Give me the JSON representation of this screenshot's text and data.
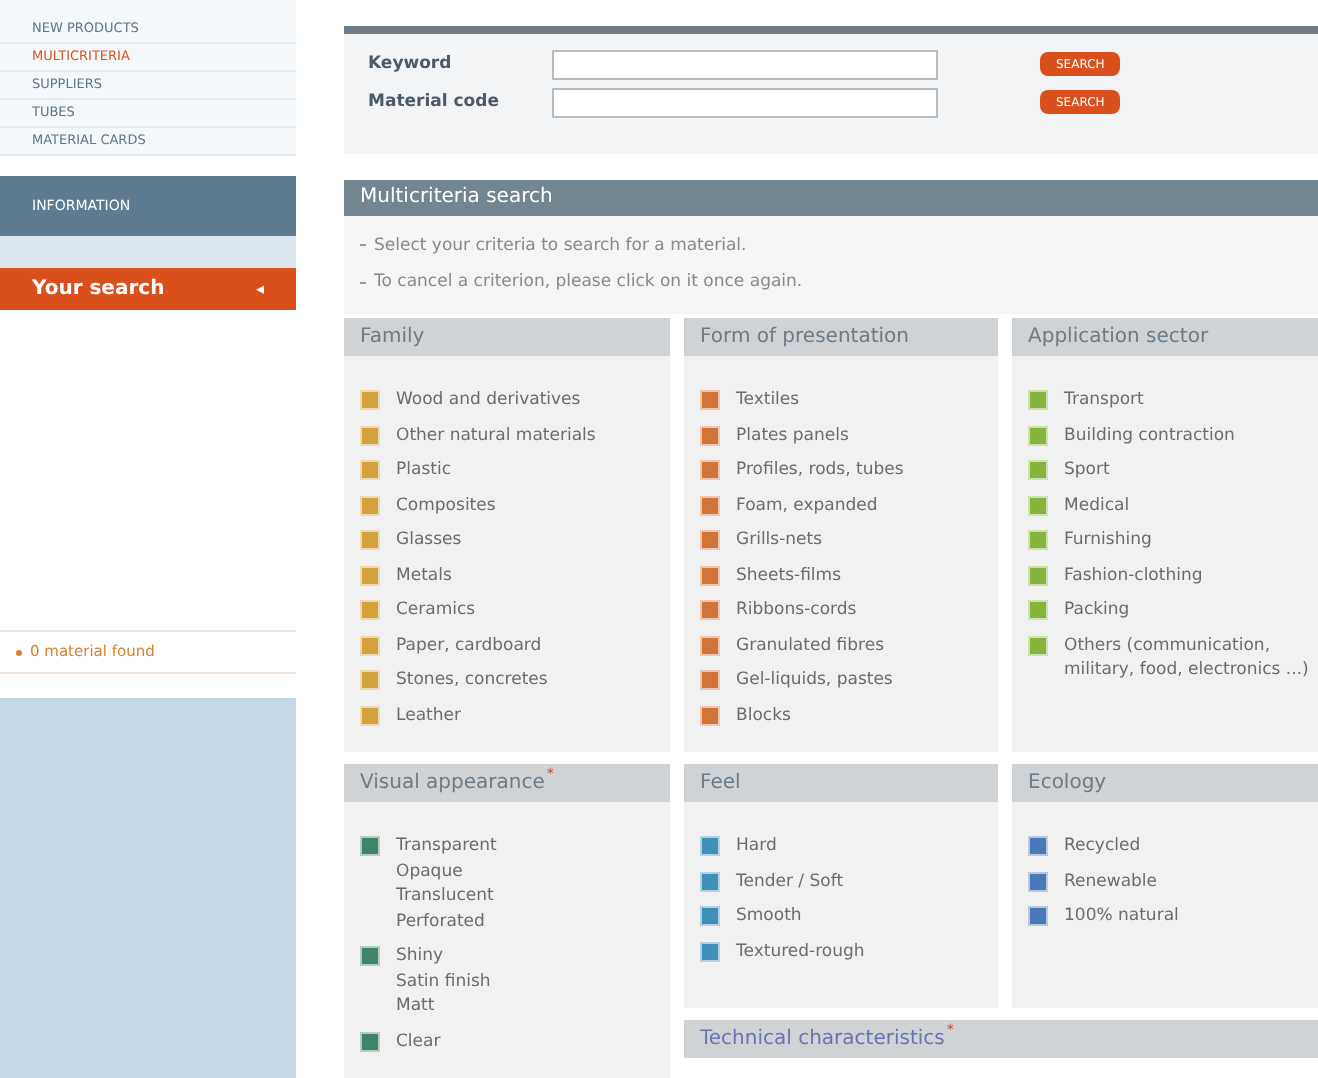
{
  "sidebar": {
    "nav": [
      {
        "label": "NEW PRODUCTS",
        "selected": false
      },
      {
        "label": "MULTICRITERIA",
        "selected": true
      },
      {
        "label": "SUPPLIERS",
        "selected": false
      },
      {
        "label": "TUBES",
        "selected": false
      },
      {
        "label": "MATERIAL CARDS",
        "selected": false
      }
    ],
    "info_title": "INFORMATION",
    "search_title": "Your search",
    "search_arrow": "◂",
    "result": "0 material found"
  },
  "search_form": {
    "fields": [
      {
        "label": "Keyword",
        "button": "SEARCH"
      },
      {
        "label": "Material code",
        "button": "SEARCH"
      }
    ]
  },
  "multicriteria": {
    "title": "Multicriteria search",
    "instructions": [
      "Select your criteria to search for a material.",
      "To cancel a criterion, please click on it once again."
    ],
    "groups": [
      {
        "title": "Family",
        "color": "#d4a23c",
        "items": [
          {
            "lines": [
              "Wood and derivatives"
            ]
          },
          {
            "lines": [
              "Other natural materials"
            ]
          },
          {
            "lines": [
              "Plastic"
            ]
          },
          {
            "lines": [
              "Composites"
            ]
          },
          {
            "lines": [
              "Glasses"
            ]
          },
          {
            "lines": [
              "Metals"
            ]
          },
          {
            "lines": [
              "Ceramics"
            ]
          },
          {
            "lines": [
              "Paper, cardboard"
            ]
          },
          {
            "lines": [
              "Stones, concretes"
            ]
          },
          {
            "lines": [
              "Leather"
            ]
          }
        ]
      },
      {
        "title": "Form of presentation",
        "color": "#d2743a",
        "items": [
          {
            "lines": [
              "Textiles"
            ]
          },
          {
            "lines": [
              "Plates panels"
            ]
          },
          {
            "lines": [
              "Profiles, rods, tubes"
            ]
          },
          {
            "lines": [
              "Foam, expanded"
            ]
          },
          {
            "lines": [
              "Grills-nets"
            ]
          },
          {
            "lines": [
              "Sheets-films"
            ]
          },
          {
            "lines": [
              "Ribbons-cords"
            ]
          },
          {
            "lines": [
              "Granulated fibres"
            ]
          },
          {
            "lines": [
              "Gel-liquids, pastes"
            ]
          },
          {
            "lines": [
              "Blocks"
            ]
          }
        ]
      },
      {
        "title": "Application sector",
        "color": "#86b33a",
        "items": [
          {
            "lines": [
              "Transport"
            ]
          },
          {
            "lines": [
              "Building contraction"
            ]
          },
          {
            "lines": [
              "Sport"
            ]
          },
          {
            "lines": [
              "Medical"
            ]
          },
          {
            "lines": [
              "Furnishing"
            ]
          },
          {
            "lines": [
              "Fashion-clothing"
            ]
          },
          {
            "lines": [
              "Packing"
            ]
          },
          {
            "lines": [
              "Others (communication, military, food, electronics ...)"
            ]
          }
        ]
      },
      {
        "title": "Visual appearance",
        "mark": "*",
        "color": "#3f8466",
        "items": [
          {
            "lines": [
              "Transparent",
              "Opaque",
              "Translucent",
              "Perforated"
            ]
          },
          {
            "lines": [
              "Shiny",
              "Satin finish",
              "Matt"
            ]
          },
          {
            "lines": [
              "Clear"
            ]
          }
        ]
      },
      {
        "title": "Feel",
        "color": "#3f8fb8",
        "items": [
          {
            "lines": [
              "Hard"
            ]
          },
          {
            "lines": [
              "Tender / Soft"
            ]
          },
          {
            "lines": [
              "Smooth"
            ]
          },
          {
            "lines": [
              "Textured-rough"
            ]
          }
        ]
      },
      {
        "title": "Ecology",
        "color": "#4a78b8",
        "items": [
          {
            "lines": [
              "Recycled"
            ]
          },
          {
            "lines": [
              "Renewable"
            ]
          },
          {
            "lines": [
              "100% natural"
            ]
          }
        ]
      }
    ],
    "technical": {
      "title": "Technical characteristics",
      "mark": "*"
    }
  }
}
